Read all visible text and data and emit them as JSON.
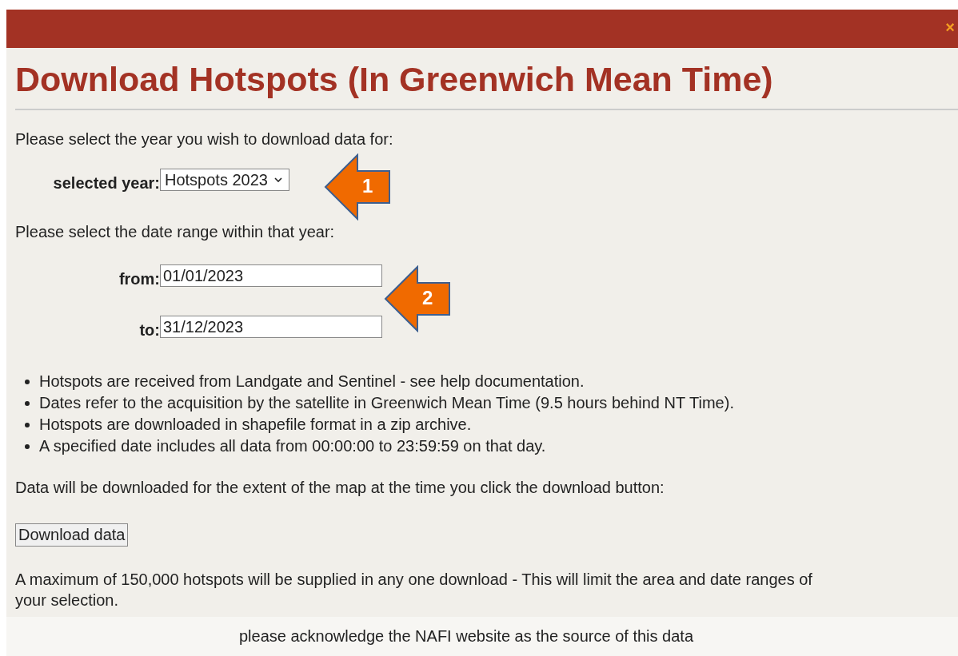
{
  "dialog": {
    "title": "Download Hotspots (In Greenwich Mean Time)",
    "close": "×"
  },
  "intro": "Please select the year you wish to download data for:",
  "year": {
    "label": "selected year:",
    "value": "Hotspots 2023"
  },
  "range_intro": "Please select the date range within that year:",
  "from": {
    "label": "from:",
    "value": "01/01/2023"
  },
  "to": {
    "label": "to:",
    "value": "31/12/2023"
  },
  "notes": [
    "Hotspots are received from Landgate and Sentinel - see help documentation.",
    "Dates refer to the acquisition by the satellite in Greenwich Mean Time (9.5 hours behind NT Time).",
    "Hotspots are downloaded in shapefile format in a zip archive.",
    "A specified date includes all data from 00:00:00 to 23:59:59 on that day."
  ],
  "extent_note": "Data will be downloaded for the extent of the map at the time you click the download button:",
  "download_button": "Download data",
  "limit_note": "A maximum of 150,000 hotspots will be supplied in any one download - This will limit the area and date ranges of your selection.",
  "footer": "please acknowledge the NAFI website as the source of this data",
  "callouts": [
    {
      "label": "1"
    },
    {
      "label": "2"
    }
  ]
}
